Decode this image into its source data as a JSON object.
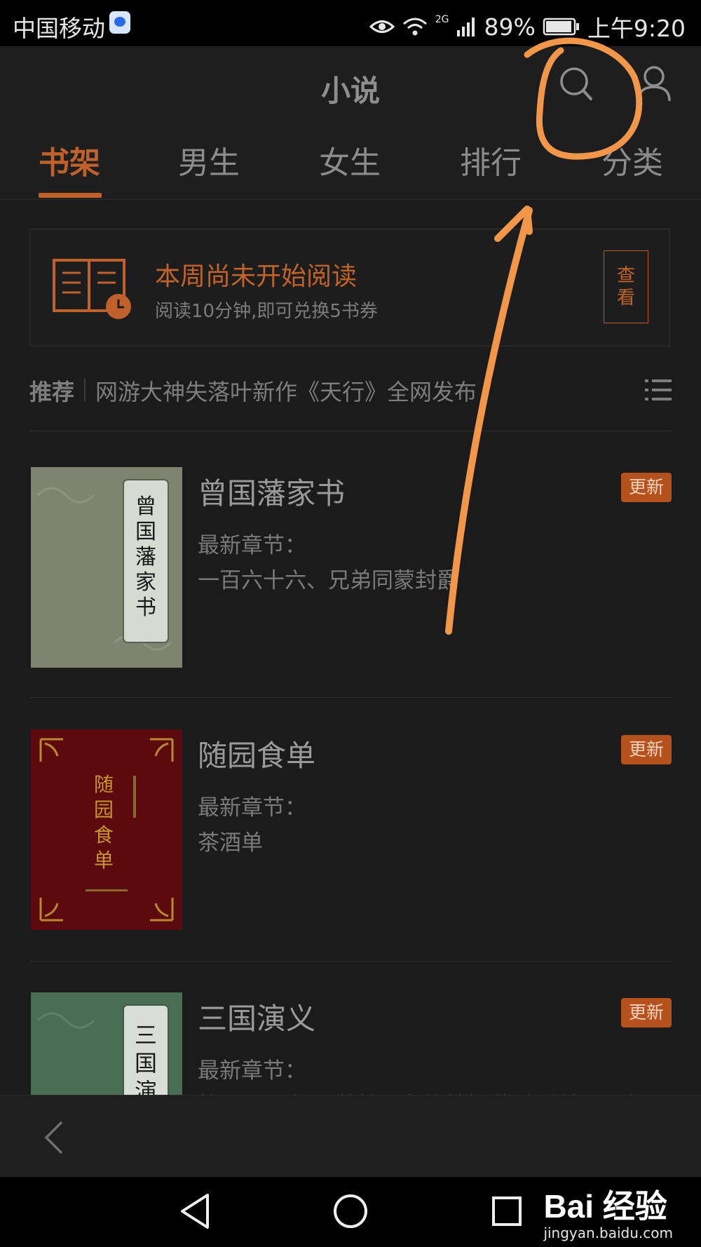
{
  "status_bar": {
    "carrier": "中国移动",
    "network": "2G",
    "battery": "89%",
    "time": "上午9:20"
  },
  "header": {
    "title": "小说",
    "tabs": [
      {
        "label": "书架",
        "active": true
      },
      {
        "label": "男生",
        "active": false
      },
      {
        "label": "女生",
        "active": false
      },
      {
        "label": "排行",
        "active": false
      },
      {
        "label": "分类",
        "active": false
      }
    ]
  },
  "reading_card": {
    "title": "本周尚未开始阅读",
    "subtitle": "阅读10分钟,即可兑换5书券",
    "button_label": "查看"
  },
  "recommend": {
    "label": "推荐",
    "text": "网游大神失落叶新作《天行》全网发布"
  },
  "books": [
    {
      "title": "曾国藩家书",
      "latest_label": "最新章节：",
      "chapter": "一百六十六、兄弟同蒙封爵",
      "badge": "更新",
      "cover_text": "曾国藩家书"
    },
    {
      "title": "随园食单",
      "latest_label": "最新章节：",
      "chapter": "茶酒单",
      "badge": "更新",
      "cover_text": "随园食单"
    },
    {
      "title": "三国演义",
      "latest_label": "最新章节：",
      "chapter": "第一百二十回 荐杜预老将献新谋 降孙皓三分归",
      "badge": "更新",
      "cover_text": "三国演"
    }
  ],
  "watermark": {
    "logo": "Bai 经验",
    "url": "jingyan.baidu.com"
  },
  "colors": {
    "accent": "#c0602a",
    "annotation": "#f2964a",
    "background": "#1b1b1b"
  }
}
